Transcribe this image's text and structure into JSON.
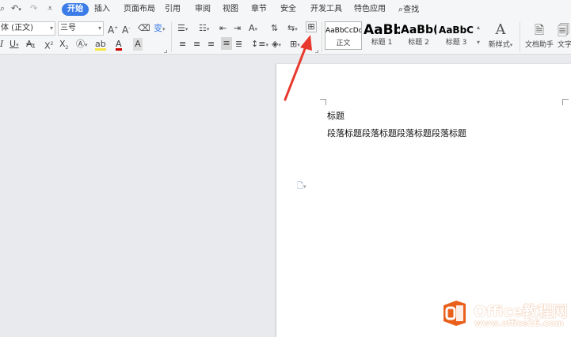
{
  "menubar": {
    "tabs": [
      "开始",
      "插入",
      "页面布局",
      "引用",
      "审阅",
      "视图",
      "章节",
      "安全",
      "开发工具",
      "特色应用"
    ],
    "search_label": "查找"
  },
  "ribbon": {
    "font_name": "体 (正文)",
    "font_size": "三号",
    "styles": [
      {
        "sample": "AaBbCcDd",
        "label": "正文"
      },
      {
        "sample": "AaBb",
        "label": "标题 1"
      },
      {
        "sample": "AaBb(",
        "label": "标题 2"
      },
      {
        "sample": "AaBbC",
        "label": "标题 3"
      }
    ],
    "new_style_label": "新样式",
    "doc_helper_label": "文档助手",
    "text_tools_label": "文字"
  },
  "document": {
    "line1": "标题",
    "line2": "段落标题段落标题段落标题段落标题"
  },
  "watermark": {
    "title": "Office教程网",
    "url": "www.office26.com"
  },
  "colors": {
    "accent": "#3b7ce8",
    "arrow": "#e8392e",
    "watermark_orange": "#e8601c"
  }
}
